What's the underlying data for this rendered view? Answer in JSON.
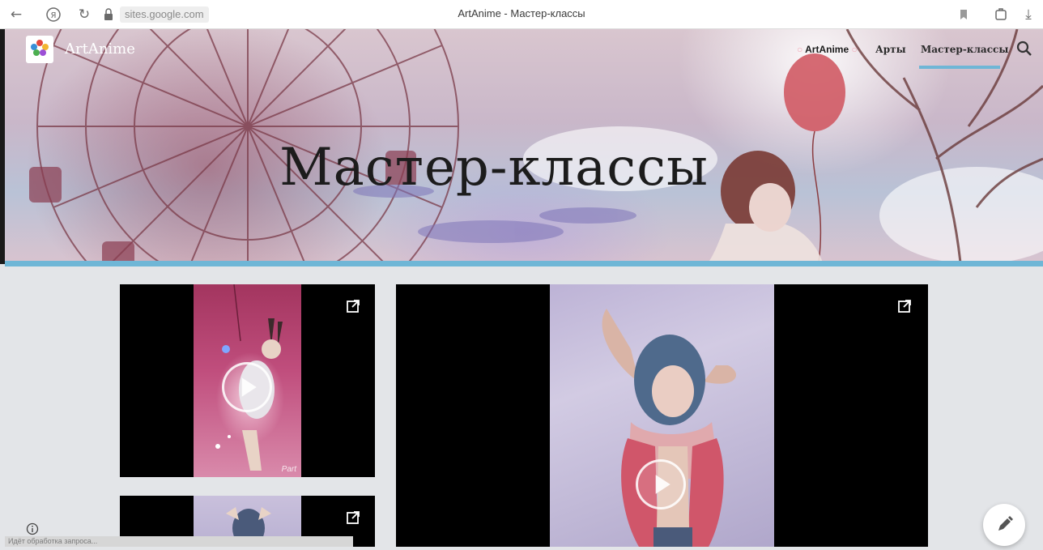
{
  "browser": {
    "url": "sites.google.com",
    "tab_title": "ArtAnime - Мастер-классы"
  },
  "site": {
    "name": "ArtAnime",
    "logo_caption": "ArtAnime"
  },
  "nav": {
    "items": [
      {
        "label": "ArtAnime",
        "active": false
      },
      {
        "label": "Арты",
        "active": false
      },
      {
        "label": "Мастер-классы",
        "active": true
      }
    ]
  },
  "hero": {
    "title": "Мастер-классы"
  },
  "videos": [
    {
      "name": "video-1",
      "watermark": "Part"
    },
    {
      "name": "video-2"
    },
    {
      "name": "video-3"
    }
  ],
  "status": {
    "text": "Идёт обработка запроса..."
  },
  "colors": {
    "accent": "#6fb6d6",
    "background": "#e3e5e8"
  }
}
